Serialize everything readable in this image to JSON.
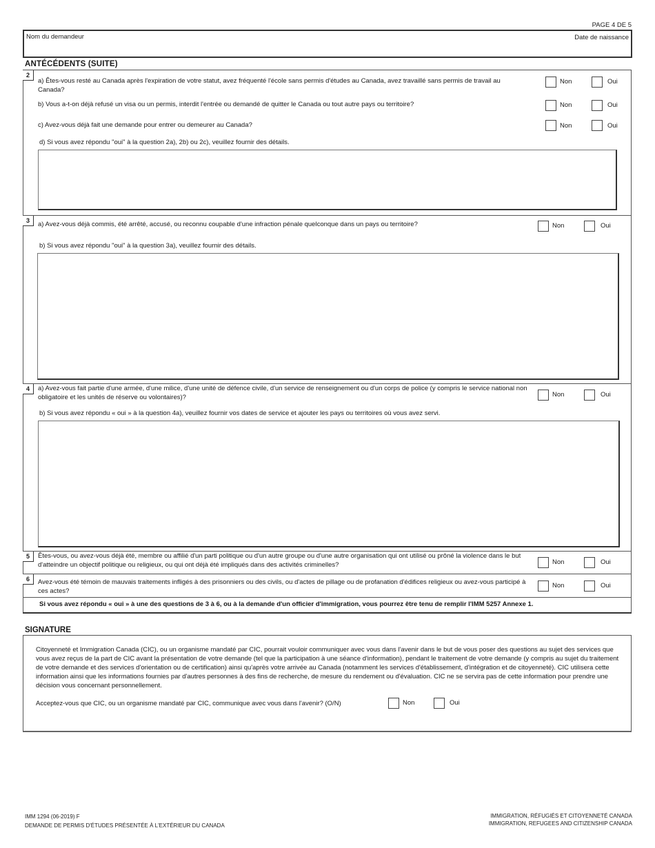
{
  "page": {
    "indicator": "PAGE 4 DE 5"
  },
  "header": {
    "applicant_name_label": "Nom du demandeur",
    "dob_label": "Date de naissance"
  },
  "section": {
    "title": "ANTÉCÉDENTS (SUITE)"
  },
  "options": {
    "no": "Non",
    "yes": "Oui"
  },
  "questions": {
    "q2": {
      "number": "2",
      "a": "a) Êtes-vous resté au Canada après l'expiration de votre statut, avez fréquenté l'école sans permis d'études au Canada, avez travaillé sans permis de travail au Canada?",
      "b": "b) Vous a-t-on déjà  refusé un visa ou un permis, interdit l'entrée ou demandé de quitter le Canada ou tout autre pays ou territoire?",
      "c": "c) Avez-vous déjà fait une demande pour entrer ou demeurer au Canada?",
      "d": "d) Si vous avez répondu \"oui\" à la question 2a), 2b)  ou 2c), veuillez fournir des détails."
    },
    "q3": {
      "number": "3",
      "a": "a) Avez-vous déjà commis, été arrêté, accusé, ou reconnu coupable d'une infraction pénale quelconque dans un pays ou territoire?",
      "b": "b) Si vous avez répondu \"oui\" à la question 3a), veuillez fournir des détails."
    },
    "q4": {
      "number": "4",
      "a": "a) Avez-vous fait partie d'une armée, d'une milice, d'une unité de défence civile, d'un service de renseignement ou d'un corps de police (y compris le service national non obligatoire et les unités de réserve ou volontaires)?",
      "b": "b) Si vous avez répondu « oui » à la question 4a), veuillez fournir vos dates de service et ajouter les pays ou territoires où vous avez servi."
    },
    "q5": {
      "number": "5",
      "text": "Êtes-vous, ou avez-vous déjà été, membre ou affilié d'un parti politique ou d'un autre groupe ou d'une autre organisation qui ont utilisé ou prôné la violence dans le but d'atteindre un objectif politique ou religieux, ou qui ont déjà été impliqués dans des activités criminelles?"
    },
    "q6": {
      "number": "6",
      "text": "Avez-vous été témoin de mauvais traitements infligés à des prisonniers ou des civils, ou d'actes de pillage ou de profanation d'édifices religieux ou avez-vous participé à ces actes?"
    },
    "notice": "Si vous avez répondu « oui » à une des questions de 3 à 6, ou à la demande d'un officier d'immigration, vous pourrez être tenu de remplir l'IMM 5257 Annexe 1."
  },
  "signature": {
    "title": "SIGNATURE",
    "paragraph": "Citoyenneté et Immigration Canada (CIC), ou un organisme mandaté par CIC, pourrait vouloir communiquer avec vous dans l'avenir dans le but de vous poser des questions au sujet des services que vous avez reçus de la part de CIC avant la présentation de votre demande (tel que la participation à une séance d'information), pendant le traitement de votre demande (y compris au sujet du traitement de votre demande et des services d'orientation ou de certification) ainsi qu'après votre arrivée au Canada (notamment les services d'établissement, d'intégration et de citoyenneté). CIC utilisera cette information ainsi que les informations fournies par d'autres personnes à des fins de recherche, de mesure du rendement ou d'évaluation. CIC ne se servira pas de cette information pour prendre une décision vous concernant personnellement.",
    "consent_question": "Acceptez-vous que CIC, ou un organisme mandaté par CIC, communique avec vous dans l'avenir? (O/N)"
  },
  "footer": {
    "form_code": "IMM 1294 (06-2019) F",
    "form_title": "DEMANDE DE PERMIS D'ÉTUDES  PRÉSENTÉE À L'EXTÉRIEUR DU CANADA",
    "dept_fr": "IMMIGRATION, RÉFUGIÉS ET CITOYENNETÉ CANADA",
    "dept_en": "IMMIGRATION, REFUGEES AND CITIZENSHIP CANADA"
  }
}
